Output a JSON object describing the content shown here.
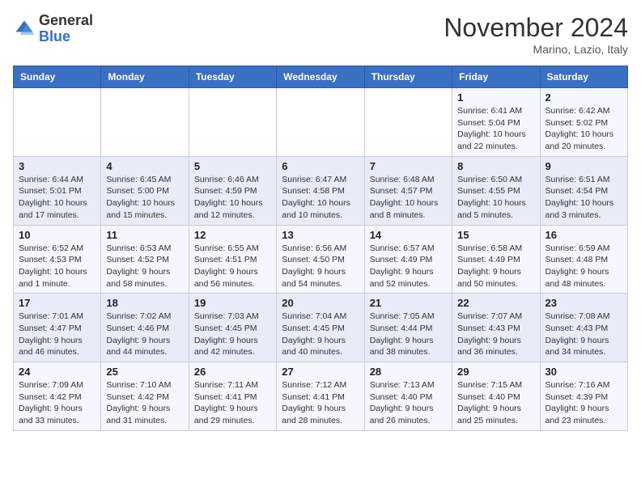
{
  "header": {
    "logo_line1": "General",
    "logo_line2": "Blue",
    "month": "November 2024",
    "location": "Marino, Lazio, Italy"
  },
  "weekdays": [
    "Sunday",
    "Monday",
    "Tuesday",
    "Wednesday",
    "Thursday",
    "Friday",
    "Saturday"
  ],
  "weeks": [
    [
      {
        "day": "",
        "info": ""
      },
      {
        "day": "",
        "info": ""
      },
      {
        "day": "",
        "info": ""
      },
      {
        "day": "",
        "info": ""
      },
      {
        "day": "",
        "info": ""
      },
      {
        "day": "1",
        "info": "Sunrise: 6:41 AM\nSunset: 5:04 PM\nDaylight: 10 hours\nand 22 minutes."
      },
      {
        "day": "2",
        "info": "Sunrise: 6:42 AM\nSunset: 5:02 PM\nDaylight: 10 hours\nand 20 minutes."
      }
    ],
    [
      {
        "day": "3",
        "info": "Sunrise: 6:44 AM\nSunset: 5:01 PM\nDaylight: 10 hours\nand 17 minutes."
      },
      {
        "day": "4",
        "info": "Sunrise: 6:45 AM\nSunset: 5:00 PM\nDaylight: 10 hours\nand 15 minutes."
      },
      {
        "day": "5",
        "info": "Sunrise: 6:46 AM\nSunset: 4:59 PM\nDaylight: 10 hours\nand 12 minutes."
      },
      {
        "day": "6",
        "info": "Sunrise: 6:47 AM\nSunset: 4:58 PM\nDaylight: 10 hours\nand 10 minutes."
      },
      {
        "day": "7",
        "info": "Sunrise: 6:48 AM\nSunset: 4:57 PM\nDaylight: 10 hours\nand 8 minutes."
      },
      {
        "day": "8",
        "info": "Sunrise: 6:50 AM\nSunset: 4:55 PM\nDaylight: 10 hours\nand 5 minutes."
      },
      {
        "day": "9",
        "info": "Sunrise: 6:51 AM\nSunset: 4:54 PM\nDaylight: 10 hours\nand 3 minutes."
      }
    ],
    [
      {
        "day": "10",
        "info": "Sunrise: 6:52 AM\nSunset: 4:53 PM\nDaylight: 10 hours\nand 1 minute."
      },
      {
        "day": "11",
        "info": "Sunrise: 6:53 AM\nSunset: 4:52 PM\nDaylight: 9 hours\nand 58 minutes."
      },
      {
        "day": "12",
        "info": "Sunrise: 6:55 AM\nSunset: 4:51 PM\nDaylight: 9 hours\nand 56 minutes."
      },
      {
        "day": "13",
        "info": "Sunrise: 6:56 AM\nSunset: 4:50 PM\nDaylight: 9 hours\nand 54 minutes."
      },
      {
        "day": "14",
        "info": "Sunrise: 6:57 AM\nSunset: 4:49 PM\nDaylight: 9 hours\nand 52 minutes."
      },
      {
        "day": "15",
        "info": "Sunrise: 6:58 AM\nSunset: 4:49 PM\nDaylight: 9 hours\nand 50 minutes."
      },
      {
        "day": "16",
        "info": "Sunrise: 6:59 AM\nSunset: 4:48 PM\nDaylight: 9 hours\nand 48 minutes."
      }
    ],
    [
      {
        "day": "17",
        "info": "Sunrise: 7:01 AM\nSunset: 4:47 PM\nDaylight: 9 hours\nand 46 minutes."
      },
      {
        "day": "18",
        "info": "Sunrise: 7:02 AM\nSunset: 4:46 PM\nDaylight: 9 hours\nand 44 minutes."
      },
      {
        "day": "19",
        "info": "Sunrise: 7:03 AM\nSunset: 4:45 PM\nDaylight: 9 hours\nand 42 minutes."
      },
      {
        "day": "20",
        "info": "Sunrise: 7:04 AM\nSunset: 4:45 PM\nDaylight: 9 hours\nand 40 minutes."
      },
      {
        "day": "21",
        "info": "Sunrise: 7:05 AM\nSunset: 4:44 PM\nDaylight: 9 hours\nand 38 minutes."
      },
      {
        "day": "22",
        "info": "Sunrise: 7:07 AM\nSunset: 4:43 PM\nDaylight: 9 hours\nand 36 minutes."
      },
      {
        "day": "23",
        "info": "Sunrise: 7:08 AM\nSunset: 4:43 PM\nDaylight: 9 hours\nand 34 minutes."
      }
    ],
    [
      {
        "day": "24",
        "info": "Sunrise: 7:09 AM\nSunset: 4:42 PM\nDaylight: 9 hours\nand 33 minutes."
      },
      {
        "day": "25",
        "info": "Sunrise: 7:10 AM\nSunset: 4:42 PM\nDaylight: 9 hours\nand 31 minutes."
      },
      {
        "day": "26",
        "info": "Sunrise: 7:11 AM\nSunset: 4:41 PM\nDaylight: 9 hours\nand 29 minutes."
      },
      {
        "day": "27",
        "info": "Sunrise: 7:12 AM\nSunset: 4:41 PM\nDaylight: 9 hours\nand 28 minutes."
      },
      {
        "day": "28",
        "info": "Sunrise: 7:13 AM\nSunset: 4:40 PM\nDaylight: 9 hours\nand 26 minutes."
      },
      {
        "day": "29",
        "info": "Sunrise: 7:15 AM\nSunset: 4:40 PM\nDaylight: 9 hours\nand 25 minutes."
      },
      {
        "day": "30",
        "info": "Sunrise: 7:16 AM\nSunset: 4:39 PM\nDaylight: 9 hours\nand 23 minutes."
      }
    ]
  ]
}
